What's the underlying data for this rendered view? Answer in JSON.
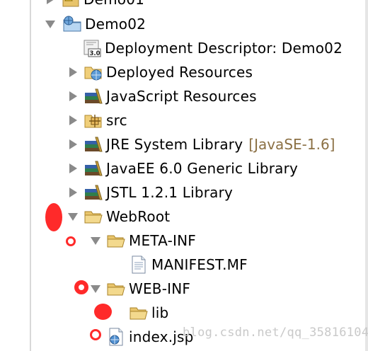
{
  "tree": {
    "partial_top_label": "Demo01",
    "project": {
      "label": "Demo02"
    },
    "items": [
      {
        "label": "Deployment Descriptor: Demo02",
        "icon": "deployment-descriptor-icon"
      },
      {
        "label": "Deployed Resources",
        "icon": "deployed-resources-folder-icon"
      },
      {
        "label": "JavaScript Resources",
        "icon": "library-icon"
      },
      {
        "label": "src",
        "icon": "package-folder-icon"
      },
      {
        "label": "JRE System Library",
        "decoration": "[JavaSE-1.6]",
        "icon": "library-icon"
      },
      {
        "label": "JavaEE 6.0 Generic Library",
        "icon": "library-icon"
      },
      {
        "label": "JSTL 1.2.1 Library",
        "icon": "library-icon"
      },
      {
        "label": "WebRoot",
        "icon": "folder-open-icon"
      },
      {
        "label": "META-INF",
        "icon": "folder-open-icon"
      },
      {
        "label": "MANIFEST.MF",
        "icon": "text-file-icon"
      },
      {
        "label": "WEB-INF",
        "icon": "folder-open-icon"
      },
      {
        "label": "lib",
        "icon": "folder-open-icon"
      },
      {
        "label": "index.jsp",
        "icon": "jsp-file-icon"
      }
    ]
  },
  "colors": {
    "annotation_red": "#ff2a2a",
    "twisty_gray": "#8a8a8a",
    "decoration_brown": "#8b7044",
    "watermark_gray": "#c9c9c9"
  },
  "watermark": "blog.csdn.net/qq_35816104"
}
